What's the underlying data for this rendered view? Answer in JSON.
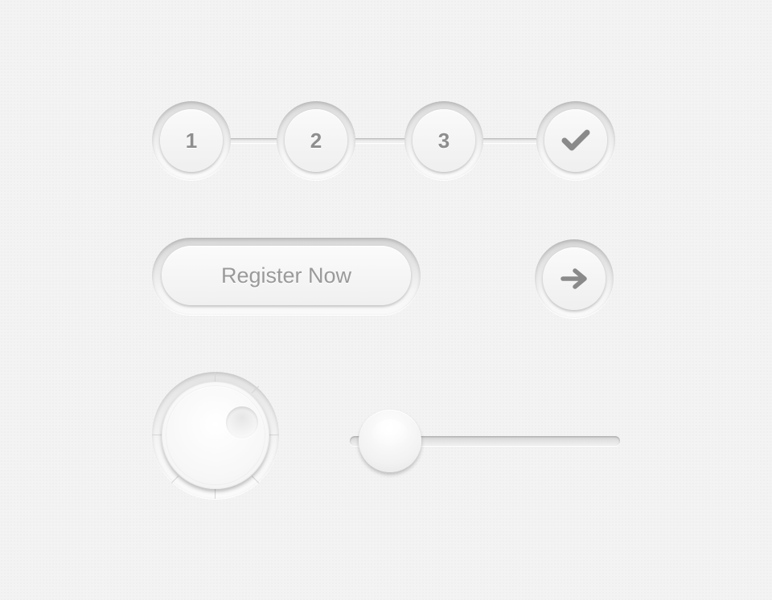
{
  "stepper": {
    "steps": [
      {
        "label": "1",
        "state": "number"
      },
      {
        "label": "2",
        "state": "number"
      },
      {
        "label": "3",
        "state": "number"
      },
      {
        "label": "",
        "state": "complete",
        "icon": "check-icon"
      }
    ]
  },
  "register_button": {
    "label": "Register Now"
  },
  "arrow_button": {
    "icon": "arrow-right-icon"
  },
  "knob": {
    "indicator_icon": "knob-indicator"
  },
  "slider": {
    "value": 0.15
  },
  "colors": {
    "background": "#f3f3f3",
    "text": "#8e8e8e",
    "icon": "#8a8a8a"
  }
}
